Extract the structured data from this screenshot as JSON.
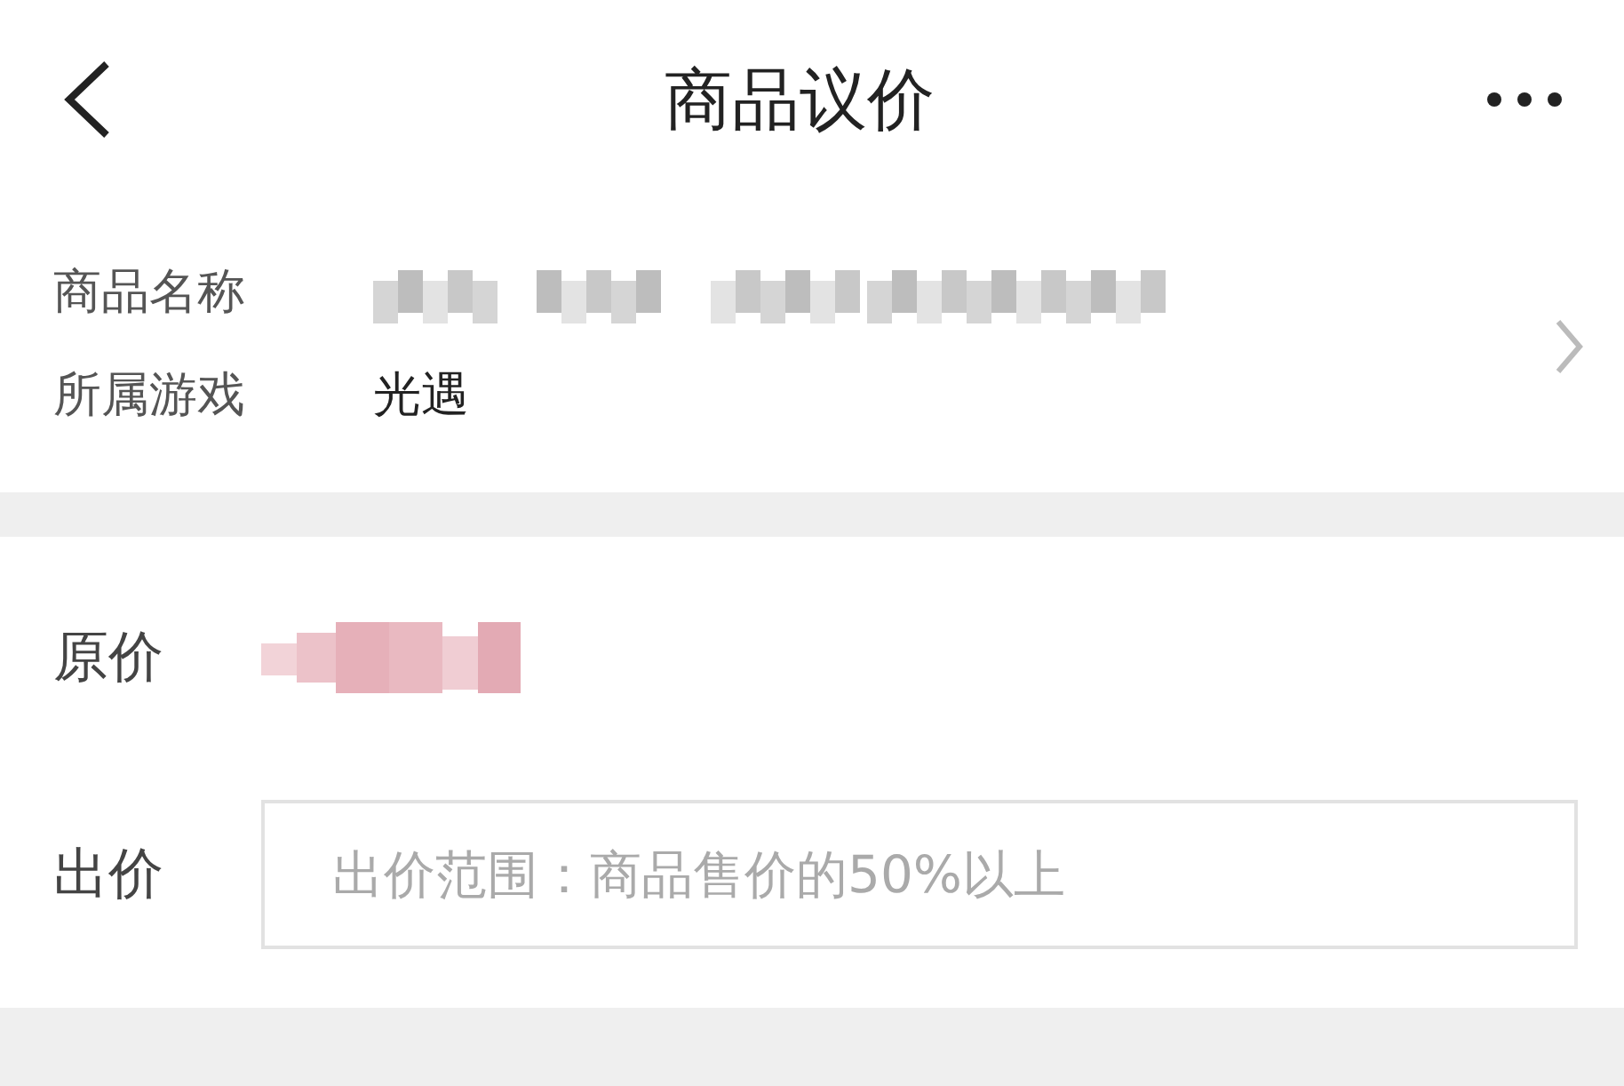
{
  "header": {
    "title": "商品议价"
  },
  "product": {
    "rows": [
      {
        "label": "商品名称",
        "kind": "masked"
      },
      {
        "label": "所属游戏",
        "kind": "text",
        "value": "光遇"
      }
    ]
  },
  "price": {
    "original_label": "原价",
    "offer_label": "出价",
    "offer_placeholder": "出价范围：商品售价的50%以上"
  }
}
